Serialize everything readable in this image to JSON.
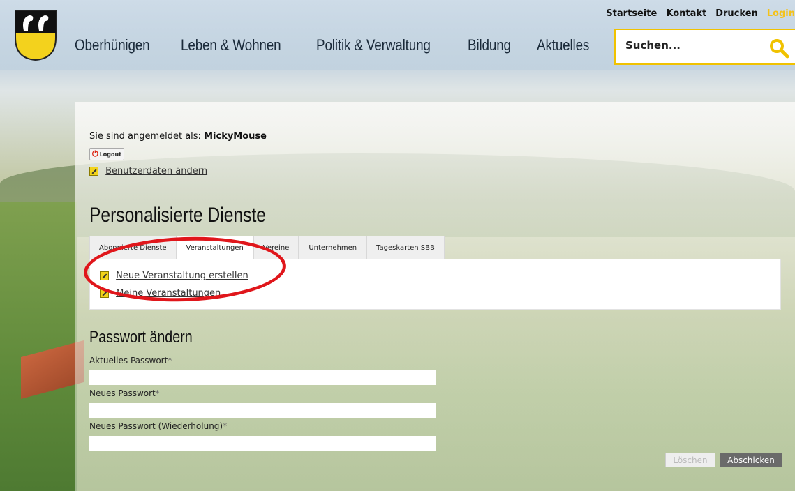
{
  "header": {
    "nav": [
      "Oberhünigen",
      "Leben & Wohnen",
      "Politik & Verwaltung",
      "Bildung",
      "Aktuelles"
    ],
    "top_links": [
      "Startseite",
      "Kontakt",
      "Drucken",
      "Login"
    ],
    "search_placeholder": "Suchen..."
  },
  "user": {
    "logged_in_prefix": "Sie sind angemeldet als:",
    "username": "MickyMouse",
    "logout_label": "Logout",
    "edit_profile_label": "Benutzerdaten ändern"
  },
  "services": {
    "title": "Personalisierte Dienste",
    "tabs": [
      "Abonnierte Dienste",
      "Veranstaltungen",
      "Vereine",
      "Unternehmen",
      "Tageskarten SBB"
    ],
    "active_tab": "Veranstaltungen",
    "links": [
      "Neue Veranstaltung erstellen",
      "Meine Veranstaltungen"
    ]
  },
  "password": {
    "title": "Passwort ändern",
    "fields": [
      "Aktuelles Passwort",
      "Neues Passwort",
      "Neues Passwort (Wiederholung)"
    ],
    "required_mark": "*",
    "reset_label": "Löschen",
    "submit_label": "Abschicken"
  },
  "colors": {
    "accent_yellow": "#f0c200",
    "highlight_red": "#e0161b",
    "submit_gray": "#6a6a6a"
  }
}
